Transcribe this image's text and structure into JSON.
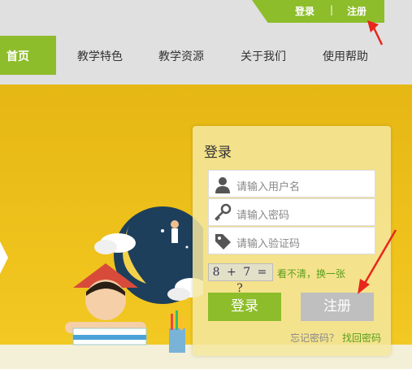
{
  "header": {
    "login_link": "登录",
    "separator": "|",
    "register_link": "注册"
  },
  "nav": {
    "home": "首页",
    "items": [
      "教学特色",
      "教学资源",
      "关于我们",
      "使用帮助"
    ]
  },
  "login": {
    "title": "登录",
    "username_placeholder": "请输入用户名",
    "password_placeholder": "请输入密码",
    "captcha_placeholder": "请输入验证码",
    "captcha_text": "8 + 7 = ?",
    "refresh_captcha": "看不清，换一张",
    "login_button": "登录",
    "register_button": "注册",
    "forgot_label": "忘记密码？",
    "retrieve_link": "找回密码"
  },
  "colors": {
    "accent_green": "#8dbd2a",
    "banner_yellow": "#efc21c",
    "annotation_red": "#e8261b"
  },
  "icons": [
    "user-icon",
    "key-icon",
    "tag-icon"
  ]
}
